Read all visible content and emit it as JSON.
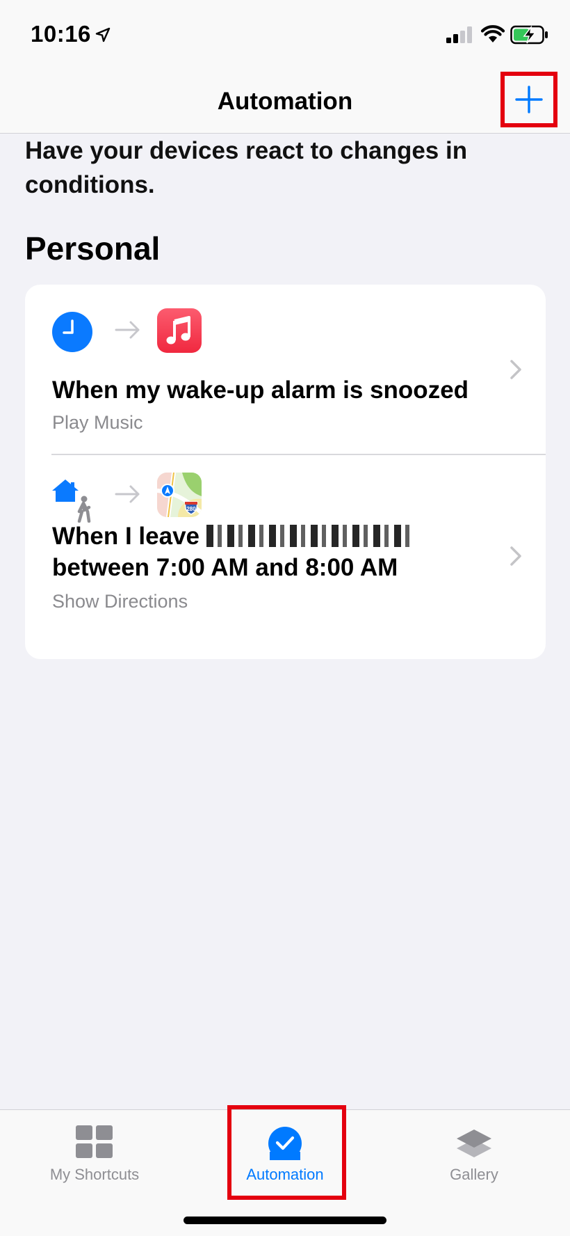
{
  "status_bar": {
    "time": "10:16"
  },
  "nav": {
    "title": "Automation",
    "add_icon": "plus-icon"
  },
  "description": "Have your devices react to changes in conditions.",
  "section": {
    "heading": "Personal"
  },
  "automations": [
    {
      "trigger_icon": "clock-icon",
      "action_icon": "music-app-icon",
      "title": "When my wake-up alarm is snoozed",
      "subtitle": "Play Music"
    },
    {
      "trigger_icon": "home-leave-icon",
      "action_icon": "maps-app-icon",
      "title_prefix": "When I leave",
      "title_line2": "between 7:00 AM and 8:00 AM",
      "subtitle": "Show Directions",
      "map_badge": "280"
    }
  ],
  "tabs": [
    {
      "label": "My Shortcuts",
      "icon": "grid-icon",
      "selected": false
    },
    {
      "label": "Automation",
      "icon": "check-circle-icon",
      "selected": true
    },
    {
      "label": "Gallery",
      "icon": "layers-icon",
      "selected": false
    }
  ],
  "colors": {
    "accent": "#007aff",
    "highlight_box": "#e4000f",
    "background": "#f2f2f7",
    "music_red": "#fa3d50",
    "battery_green": "#34c759"
  }
}
